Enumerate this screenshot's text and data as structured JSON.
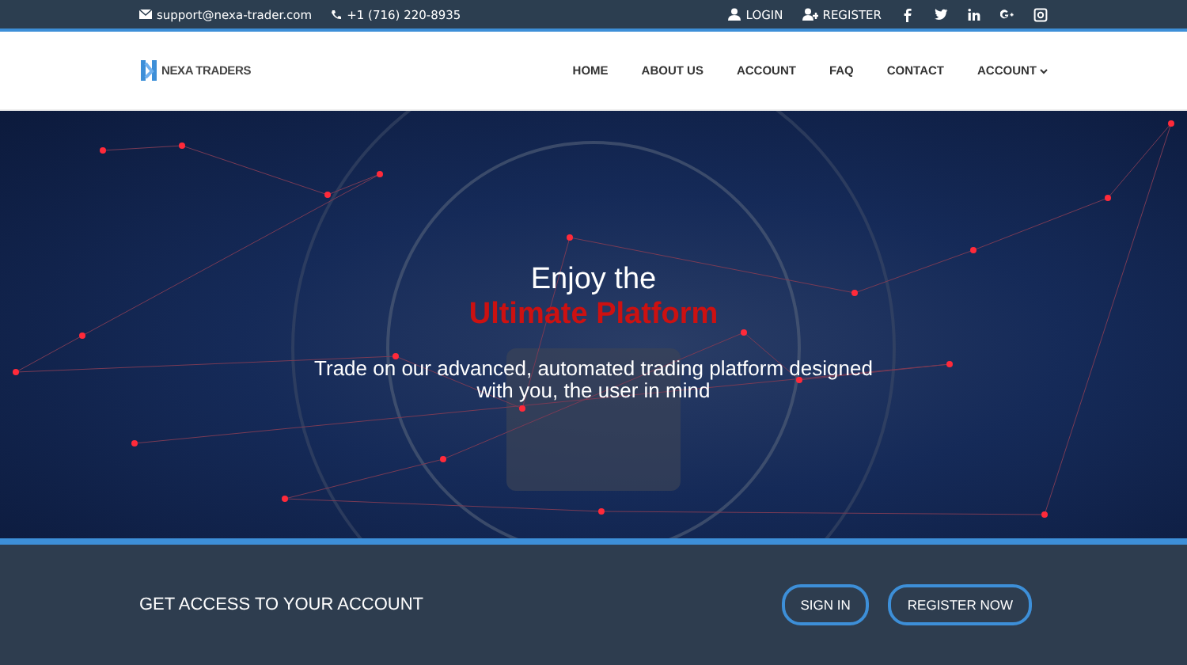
{
  "topbar": {
    "email": "support@nexa-trader.com",
    "phone": "+1 (716) 220-8935",
    "links": [
      {
        "kind": "login",
        "label": "LOGIN"
      },
      {
        "kind": "register",
        "label": "REGISTER"
      }
    ],
    "social": [
      {
        "kind": "facebook"
      },
      {
        "kind": "twitter"
      },
      {
        "kind": "linkedin"
      },
      {
        "kind": "google"
      },
      {
        "kind": "instagram"
      }
    ]
  },
  "logo": {
    "text": "NEXA TRADERS"
  },
  "nav": [
    {
      "label": "HOME",
      "dropdown": false
    },
    {
      "label": "ABOUT US",
      "dropdown": false
    },
    {
      "label": "ACCOUNT",
      "dropdown": false
    },
    {
      "label": "FAQ",
      "dropdown": false
    },
    {
      "label": "CONTACT",
      "dropdown": false
    },
    {
      "label": "ACCOUNT",
      "dropdown": true
    }
  ],
  "hero": {
    "title": "Enjoy the",
    "highlight": "Ultimate Platform",
    "subtitle": "Trade on our advanced, automated trading platform designed with you, the user in mind"
  },
  "cta": {
    "text": "GET ACCESS TO YOUR ACCOUNT",
    "buttons": [
      "SIGN IN",
      "REGISTER NOW"
    ]
  }
}
